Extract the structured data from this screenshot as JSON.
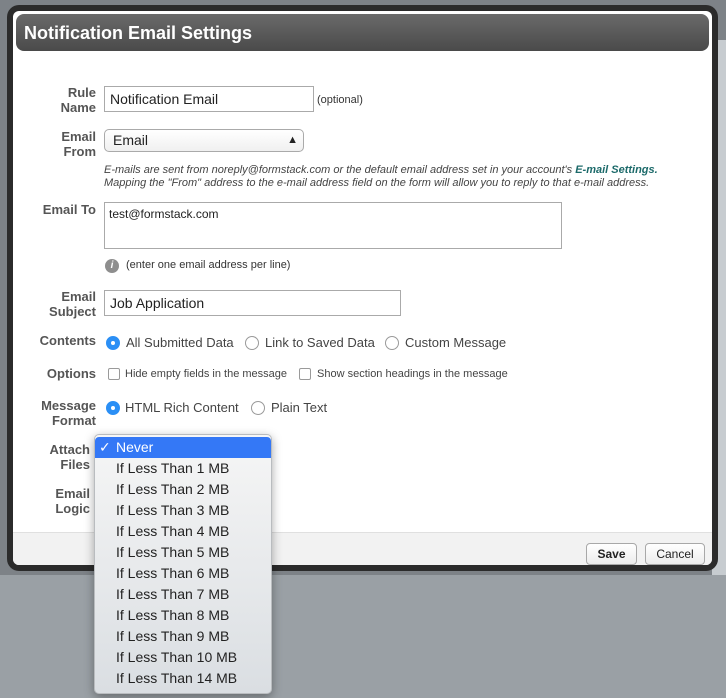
{
  "dialog": {
    "title": "Notification Email Settings"
  },
  "rule_name": {
    "label_line1": "Rule",
    "label_line2": "Name",
    "value": "Notification Email",
    "hint": "(optional)"
  },
  "email_from": {
    "label_line1": "Email",
    "label_line2": "From",
    "selected": "Email",
    "help_line1_prefix": "E-mails are sent from noreply@formstack.com or the default email address set in your account's ",
    "help_link": "E-mail Settings.",
    "help_line2": "Mapping the \"From\" address to the e-mail address field on the form will allow you to reply to that e-mail address."
  },
  "email_to": {
    "label": "Email To",
    "value": "test@formstack.com",
    "info_icon": "i",
    "hint": "(enter one email address per line)"
  },
  "email_subject": {
    "label_line1": "Email",
    "label_line2": "Subject",
    "value": "Job Application"
  },
  "contents": {
    "label": "Contents",
    "options": [
      "All Submitted Data",
      "Link to Saved Data",
      "Custom Message"
    ],
    "selected_index": 0
  },
  "options": {
    "label": "Options",
    "checkboxes": [
      "Hide empty fields in the message",
      "Show section headings in the message"
    ]
  },
  "message_format": {
    "label_line1": "Message",
    "label_line2": "Format",
    "options": [
      "HTML Rich Content",
      "Plain Text"
    ],
    "selected_index": 0
  },
  "attach_files": {
    "label_line1": "Attach",
    "label_line2": "Files",
    "checkmark": "✓",
    "options": [
      "Never",
      "If Less Than 1 MB",
      "If Less Than 2 MB",
      "If Less Than 3 MB",
      "If Less Than 4 MB",
      "If Less Than 5 MB",
      "If Less Than 6 MB",
      "If Less Than 7 MB",
      "If Less Than 8 MB",
      "If Less Than 9 MB",
      "If Less Than 10 MB",
      "If Less Than 14 MB"
    ],
    "selected_index": 0
  },
  "email_logic": {
    "label_line1": "Email",
    "label_line2": "Logic"
  },
  "footer": {
    "save_label": "Save",
    "cancel_label": "Cancel"
  },
  "colors": {
    "accent": "#2b8ff5",
    "dropdown_selected": "#3478f6",
    "header_bg": "#555555",
    "link": "#1c6a6a"
  }
}
